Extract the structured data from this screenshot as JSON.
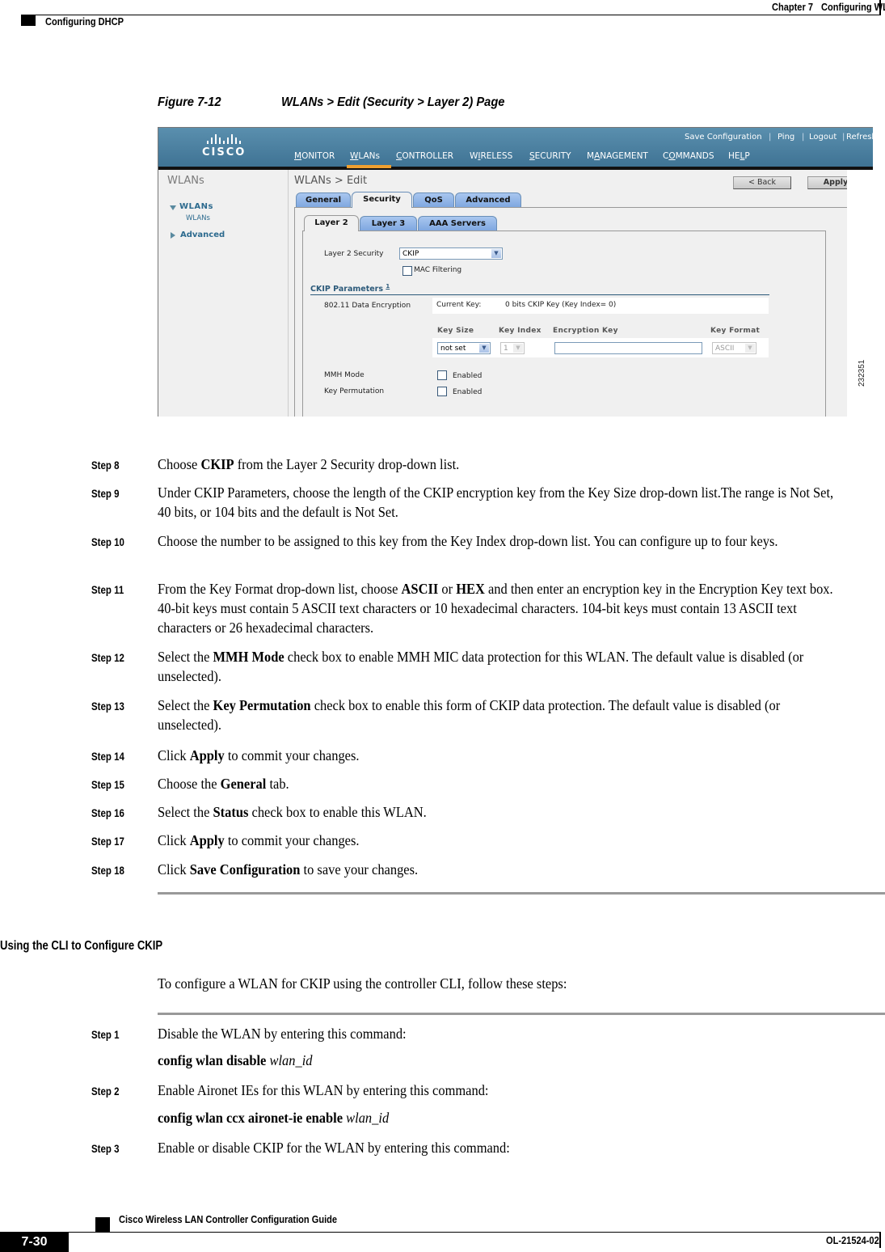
{
  "header": {
    "chapter": "Chapter 7",
    "chapter_title": "Configuring WLANs",
    "section": "Configuring DHCP"
  },
  "figure": {
    "number": "Figure 7-12",
    "title": "WLANs > Edit (Security > Layer 2) Page",
    "id": "232351"
  },
  "ui": {
    "brand": "CISCO",
    "top_links": [
      "Save Configuration",
      "Ping",
      "Logout",
      "Refresh"
    ],
    "nav": [
      {
        "pre": "",
        "u": "M",
        "post": "ONITOR"
      },
      {
        "pre": "",
        "u": "W",
        "post": "LANs"
      },
      {
        "pre": "",
        "u": "C",
        "post": "ONTROLLER"
      },
      {
        "pre": "W",
        "u": "I",
        "post": "RELESS"
      },
      {
        "pre": "",
        "u": "S",
        "post": "ECURITY"
      },
      {
        "pre": "M",
        "u": "A",
        "post": "NAGEMENT"
      },
      {
        "pre": "C",
        "u": "O",
        "post": "MMANDS"
      },
      {
        "pre": "HE",
        "u": "L",
        "post": "P"
      }
    ],
    "active_nav": "WLANs",
    "sidebar": {
      "title": "WLANs",
      "items": [
        {
          "label": "WLANs",
          "expanded": true,
          "children": [
            "WLANs"
          ]
        },
        {
          "label": "Advanced",
          "expanded": false
        }
      ]
    },
    "page_title": "WLANs > Edit",
    "buttons": {
      "back": "< Back",
      "apply": "Apply"
    },
    "tabs": [
      "General",
      "Security",
      "QoS",
      "Advanced"
    ],
    "active_tab": "Security",
    "subtabs": [
      "Layer 2",
      "Layer 3",
      "AAA Servers"
    ],
    "active_subtab": "Layer 2",
    "layer2_security": {
      "label": "Layer 2 Security",
      "value": "CKIP"
    },
    "mac_filtering": {
      "label": "MAC Filtering",
      "checked": false
    },
    "ckip": {
      "title": "CKIP Parameters",
      "footnote": "1",
      "data_encryption_label": "802.11 Data Encryption",
      "current_key_label": "Current Key:",
      "current_key_value": "0 bits CKIP Key (Key Index= 0)",
      "columns": [
        "Key Size",
        "Key Index",
        "Encryption Key",
        "Key Format"
      ],
      "key_size": "not set",
      "key_index": "1",
      "encryption_key": "",
      "key_format": "ASCII",
      "mmh_mode": {
        "label": "MMH Mode",
        "option": "Enabled",
        "checked": false
      },
      "key_permutation": {
        "label": "Key Permutation",
        "option": "Enabled",
        "checked": false
      }
    }
  },
  "steps_gui": [
    {
      "label": "Step 8",
      "parts": [
        [
          "Choose ",
          false
        ],
        [
          "CKIP",
          true
        ],
        [
          " from the Layer 2 Security drop-down list.",
          false
        ]
      ]
    },
    {
      "label": "Step 9",
      "parts": [
        [
          "Under CKIP Parameters, choose the length of the CKIP encryption key from the Key Size drop-down list.The range is Not Set, 40 bits, or 104 bits and the default is Not Set.",
          false
        ]
      ]
    },
    {
      "label": "Step 10",
      "parts": [
        [
          "Choose the number to be assigned to this key from the Key Index drop-down list. You can configure up to four keys.",
          false
        ]
      ]
    },
    {
      "label": "Step 11",
      "parts": [
        [
          "From the Key Format drop-down list, choose ",
          false
        ],
        [
          "ASCII",
          true
        ],
        [
          " or ",
          false
        ],
        [
          "HEX",
          true
        ],
        [
          " and then enter an encryption key in the Encryption Key text box. 40-bit keys must contain 5 ASCII text characters or 10 hexadecimal characters. 104-bit keys must contain 13 ASCII text characters or 26 hexadecimal characters.",
          false
        ]
      ]
    },
    {
      "label": "Step 12",
      "parts": [
        [
          "Select the ",
          false
        ],
        [
          "MMH Mode",
          true
        ],
        [
          " check box to enable MMH MIC data protection for this WLAN. The default value is disabled (or unselected).",
          false
        ]
      ]
    },
    {
      "label": "Step 13",
      "parts": [
        [
          "Select the ",
          false
        ],
        [
          "Key Permutation",
          true
        ],
        [
          " check box to enable this form of CKIP data protection. The default value is disabled (or unselected).",
          false
        ]
      ]
    },
    {
      "label": "Step 14",
      "parts": [
        [
          "Click ",
          false
        ],
        [
          "Apply",
          true
        ],
        [
          " to commit your changes.",
          false
        ]
      ]
    },
    {
      "label": "Step 15",
      "parts": [
        [
          "Choose the ",
          false
        ],
        [
          "General",
          true
        ],
        [
          " tab.",
          false
        ]
      ]
    },
    {
      "label": "Step 16",
      "parts": [
        [
          "Select the ",
          false
        ],
        [
          "Status",
          true
        ],
        [
          " check box to enable this WLAN.",
          false
        ]
      ]
    },
    {
      "label": "Step 17",
      "parts": [
        [
          "Click ",
          false
        ],
        [
          "Apply",
          true
        ],
        [
          " to commit your changes.",
          false
        ]
      ]
    },
    {
      "label": "Step 18",
      "parts": [
        [
          "Click ",
          false
        ],
        [
          "Save Configuration",
          true
        ],
        [
          " to save your changes.",
          false
        ]
      ]
    }
  ],
  "cli_section": {
    "heading": "Using the CLI to Configure CKIP",
    "intro": "To configure a WLAN for CKIP using the controller CLI, follow these steps:",
    "steps": [
      {
        "label": "Step 1",
        "text": "Disable the WLAN by entering this command:",
        "cmd": "config wlan disable",
        "arg": "wlan_id"
      },
      {
        "label": "Step 2",
        "text": "Enable Aironet IEs for this WLAN by entering this command:",
        "cmd": "config wlan ccx aironet-ie enable",
        "arg": "wlan_id"
      },
      {
        "label": "Step 3",
        "text": "Enable or disable CKIP for the WLAN by entering this command:"
      }
    ]
  },
  "footer": {
    "guide_title": "Cisco Wireless LAN Controller Configuration Guide",
    "page": "7-30",
    "doc_id": "OL-21524-02"
  }
}
